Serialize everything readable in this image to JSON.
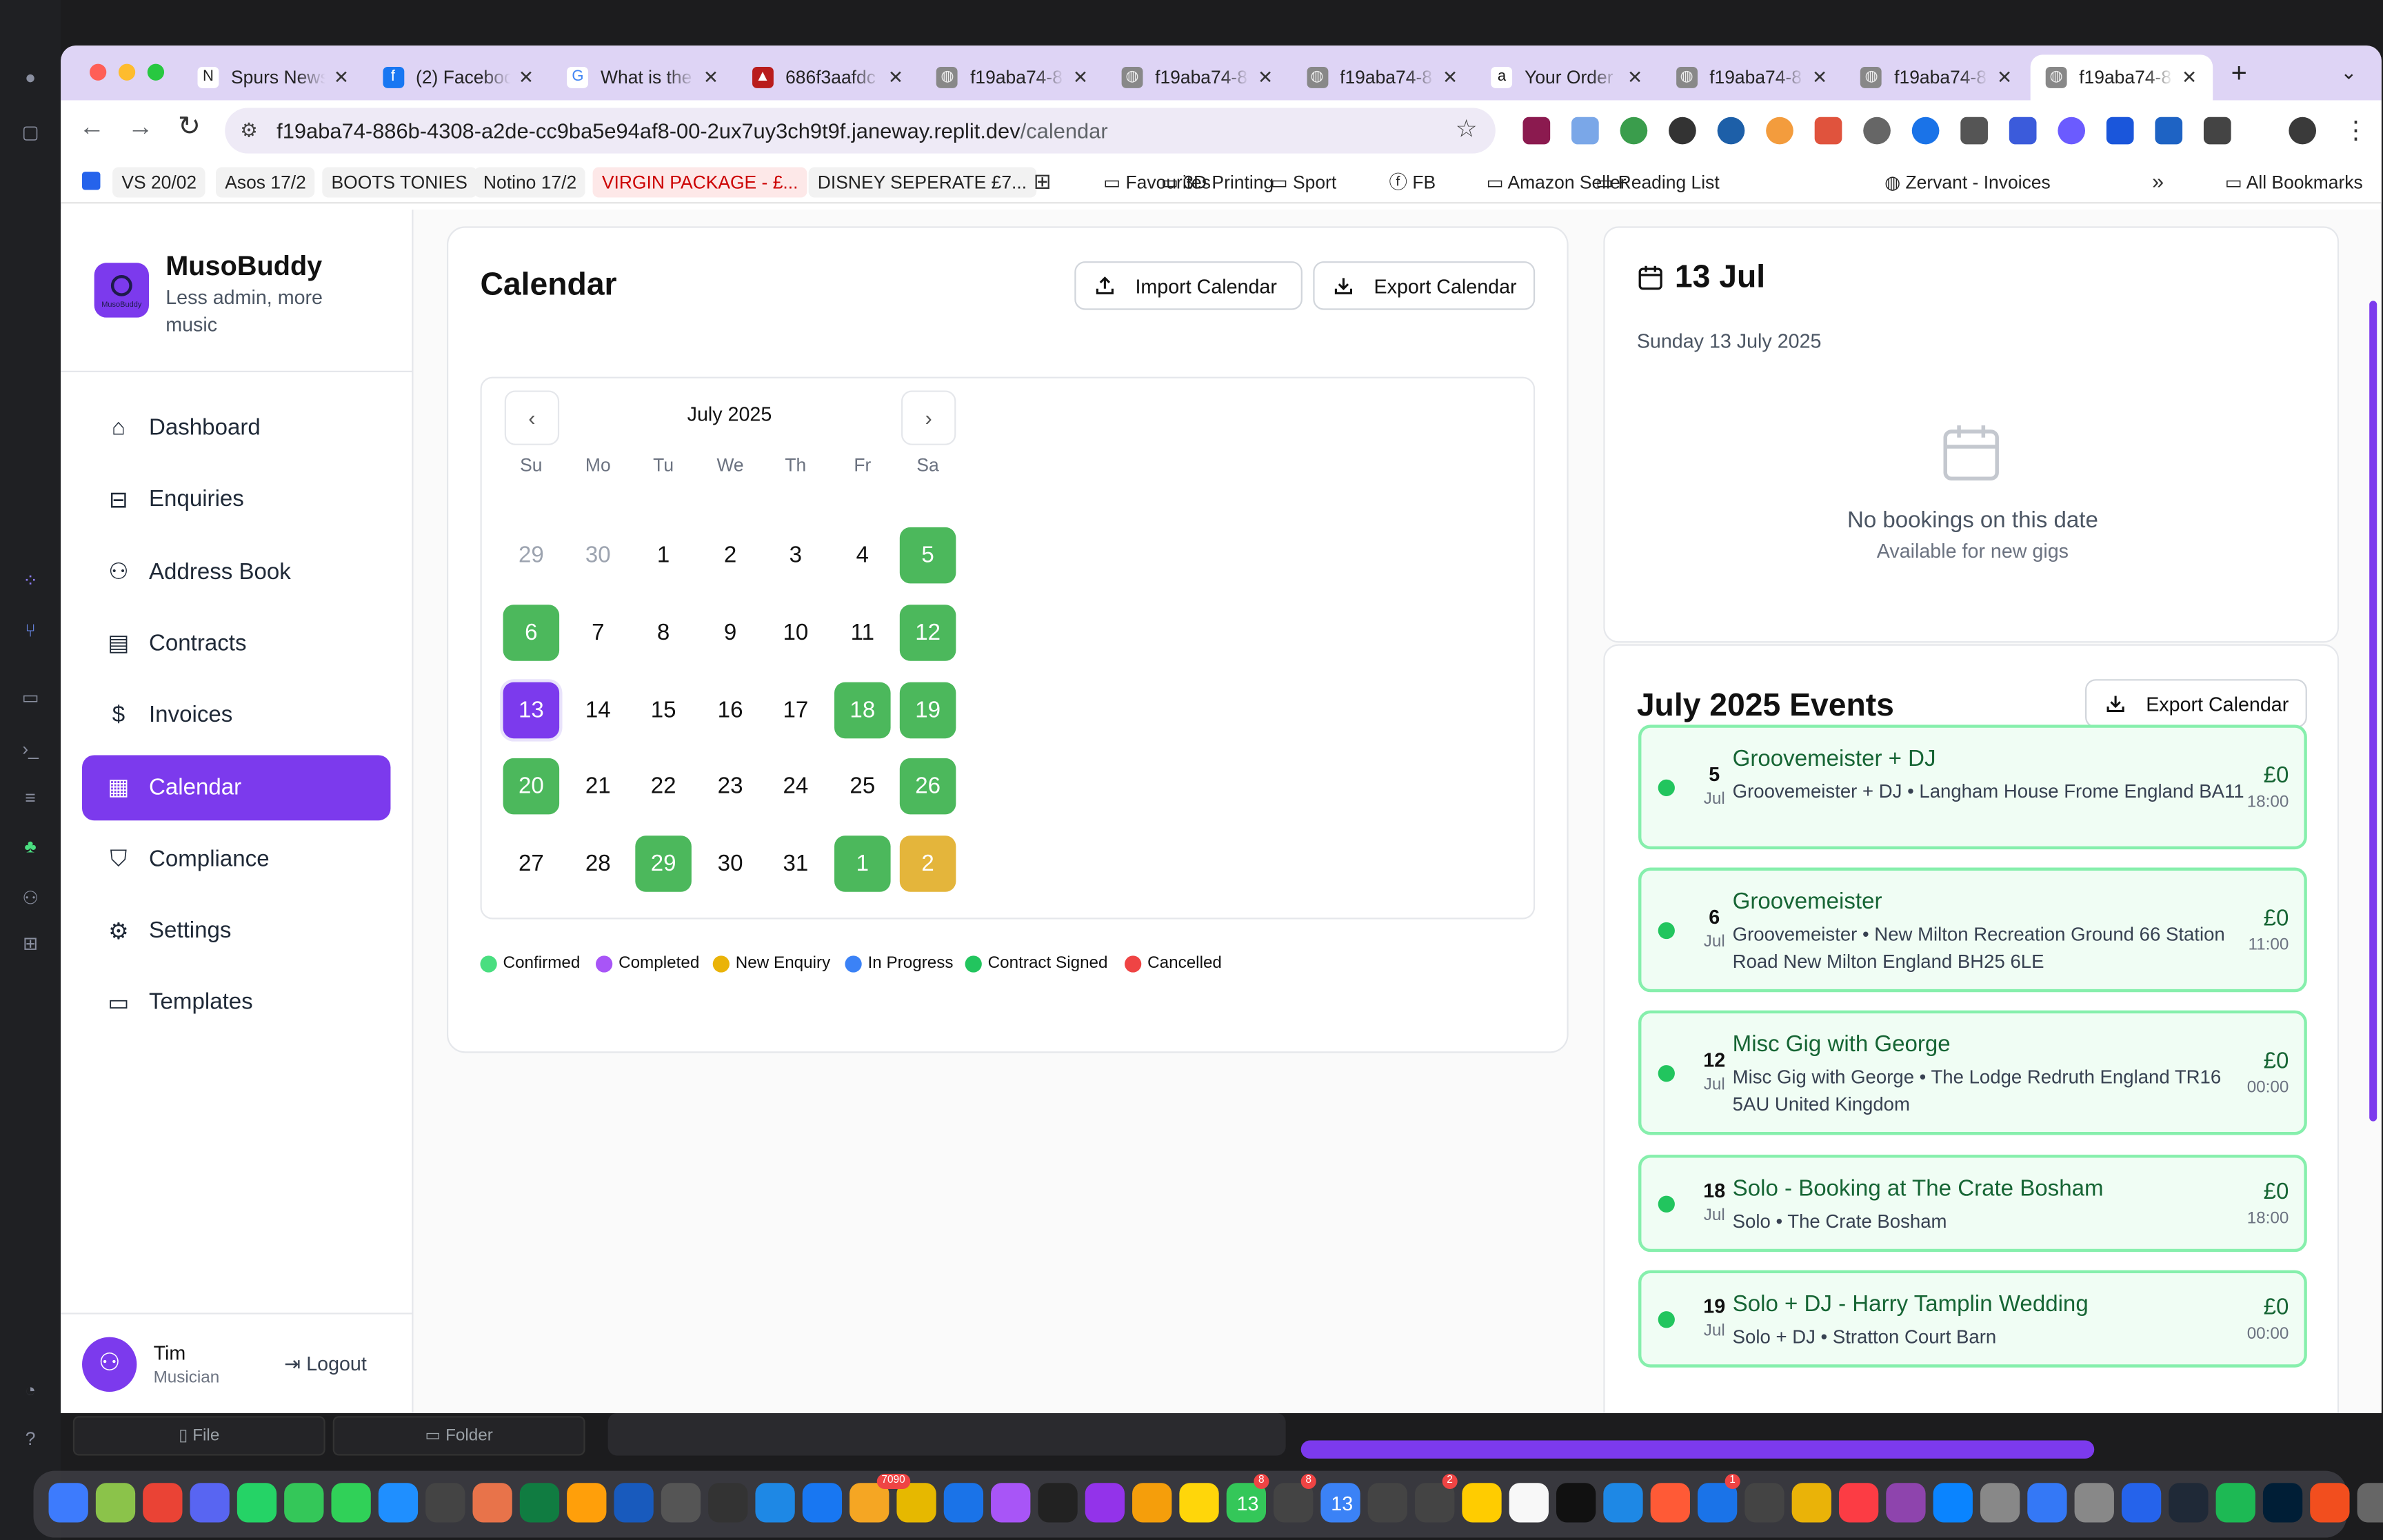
{
  "browser": {
    "tabs": [
      {
        "title": "Spurs News",
        "favicon": "N"
      },
      {
        "title": "(2) Facebook",
        "favicon": "f"
      },
      {
        "title": "What is the",
        "favicon": "G"
      },
      {
        "title": "686f3aafdc",
        "favicon": "pdf"
      },
      {
        "title": "f19aba74-8",
        "favicon": "globe"
      },
      {
        "title": "f19aba74-8",
        "favicon": "globe"
      },
      {
        "title": "f19aba74-8",
        "favicon": "globe"
      },
      {
        "title": "Your Order",
        "favicon": "a"
      },
      {
        "title": "f19aba74-8",
        "favicon": "globe"
      },
      {
        "title": "f19aba74-8",
        "favicon": "globe"
      },
      {
        "title": "f19aba74-8",
        "favicon": "globe"
      }
    ],
    "new_tab": "+",
    "url_host": "f19aba74-886b-4308-a2de-cc9ba5e94af8-00-2ux7uy3ch9t9f.janeway.replit.dev",
    "url_path": "/calendar",
    "bookmarks": [
      "VS 20/02",
      "Asos 17/2",
      "BOOTS TONIES",
      "Notino 17/2",
      "VIRGIN PACKAGE - £...",
      "DISNEY SEPERATE £7...",
      "Favourites",
      "3D Printing",
      "Sport",
      "FB",
      "Amazon Seller",
      "Reading List",
      "Zervant - Invoices"
    ],
    "more_bookmarks": "»",
    "all_bookmarks": "All Bookmarks"
  },
  "app": {
    "brand_name": "MusoBuddy",
    "brand_tagline_1": "Less admin, more",
    "brand_tagline_2": "music",
    "logo_text": "MusoBuddy",
    "nav": [
      {
        "label": "Dashboard",
        "icon": "home-icon"
      },
      {
        "label": "Enquiries",
        "icon": "inbox-icon"
      },
      {
        "label": "Address Book",
        "icon": "users-icon"
      },
      {
        "label": "Contracts",
        "icon": "file-text-icon"
      },
      {
        "label": "Invoices",
        "icon": "dollar-icon"
      },
      {
        "label": "Calendar",
        "icon": "calendar-icon",
        "active": true
      },
      {
        "label": "Compliance",
        "icon": "shield-icon"
      },
      {
        "label": "Settings",
        "icon": "gear-icon"
      },
      {
        "label": "Templates",
        "icon": "message-square-icon"
      }
    ],
    "user": {
      "name": "Tim",
      "role": "Musician",
      "logout": "Logout"
    }
  },
  "calendar": {
    "title": "Calendar",
    "import_label": "Import Calendar",
    "export_label": "Export Calendar",
    "month_label": "July 2025",
    "weekdays": [
      "Su",
      "Mo",
      "Tu",
      "We",
      "Th",
      "Fr",
      "Sa"
    ],
    "weeks": [
      [
        {
          "d": "29",
          "s": "other"
        },
        {
          "d": "30",
          "s": "other"
        },
        {
          "d": "1"
        },
        {
          "d": "2"
        },
        {
          "d": "3"
        },
        {
          "d": "4"
        },
        {
          "d": "5",
          "s": "confirmed"
        }
      ],
      [
        {
          "d": "6",
          "s": "confirmed"
        },
        {
          "d": "7"
        },
        {
          "d": "8"
        },
        {
          "d": "9"
        },
        {
          "d": "10"
        },
        {
          "d": "11"
        },
        {
          "d": "12",
          "s": "confirmed"
        }
      ],
      [
        {
          "d": "13",
          "s": "selected"
        },
        {
          "d": "14"
        },
        {
          "d": "15"
        },
        {
          "d": "16"
        },
        {
          "d": "17"
        },
        {
          "d": "18",
          "s": "confirmed"
        },
        {
          "d": "19",
          "s": "confirmed"
        }
      ],
      [
        {
          "d": "20",
          "s": "confirmed"
        },
        {
          "d": "21"
        },
        {
          "d": "22"
        },
        {
          "d": "23"
        },
        {
          "d": "24"
        },
        {
          "d": "25"
        },
        {
          "d": "26",
          "s": "confirmed"
        }
      ],
      [
        {
          "d": "27"
        },
        {
          "d": "28"
        },
        {
          "d": "29",
          "s": "confirmed"
        },
        {
          "d": "30"
        },
        {
          "d": "31"
        },
        {
          "d": "1",
          "s": "confirmed"
        },
        {
          "d": "2",
          "s": "enquiry"
        }
      ]
    ],
    "legend": [
      {
        "label": "Confirmed",
        "color": "#4ade80"
      },
      {
        "label": "Completed",
        "color": "#a855f7"
      },
      {
        "label": "New Enquiry",
        "color": "#eab308"
      },
      {
        "label": "In Progress",
        "color": "#3b82f6"
      },
      {
        "label": "Contract Signed",
        "color": "#22c55e"
      },
      {
        "label": "Cancelled",
        "color": "#ef4444"
      }
    ],
    "colors": {
      "confirmed": "#4cb85c",
      "selected": "#7c3aed",
      "enquiry": "#e4b53b",
      "accent": "#7c3aed"
    }
  },
  "day_panel": {
    "date_short": "13 Jul",
    "date_long": "Sunday 13 July 2025",
    "empty_title": "No bookings on this date",
    "empty_sub": "Available for new gigs"
  },
  "events_panel": {
    "title": "July 2025 Events",
    "export_label": "Export Calendar",
    "events": [
      {
        "day": "5",
        "month": "Jul",
        "title": "Groovemeister + DJ",
        "sub": "Groovemeister + DJ • Langham House Frome England BA11",
        "price": "£0",
        "time": "18:00"
      },
      {
        "day": "6",
        "month": "Jul",
        "title": "Groovemeister",
        "sub": "Groovemeister • New Milton Recreation Ground 66 Station Road New Milton England BH25 6LE",
        "price": "£0",
        "time": "11:00"
      },
      {
        "day": "12",
        "month": "Jul",
        "title": "Misc Gig with George",
        "sub": "Misc Gig with George • The Lodge Redruth England TR16 5AU United Kingdom",
        "price": "£0",
        "time": "00:00"
      },
      {
        "day": "18",
        "month": "Jul",
        "title": "Solo - Booking at The Crate Bosham",
        "sub": "Solo • The Crate Bosham",
        "price": "£0",
        "time": "18:00"
      },
      {
        "day": "19",
        "month": "Jul",
        "title": "Solo + DJ - Harry Tamplin Wedding",
        "sub": "Solo + DJ • Stratton Court Barn",
        "price": "£0",
        "time": "00:00"
      }
    ]
  },
  "behind": {
    "file_label": "File",
    "folder_label": "Folder"
  },
  "dock": {
    "badges": [
      "7090",
      "8",
      "8",
      "2",
      "1"
    ],
    "dates": [
      "13",
      "13"
    ]
  }
}
